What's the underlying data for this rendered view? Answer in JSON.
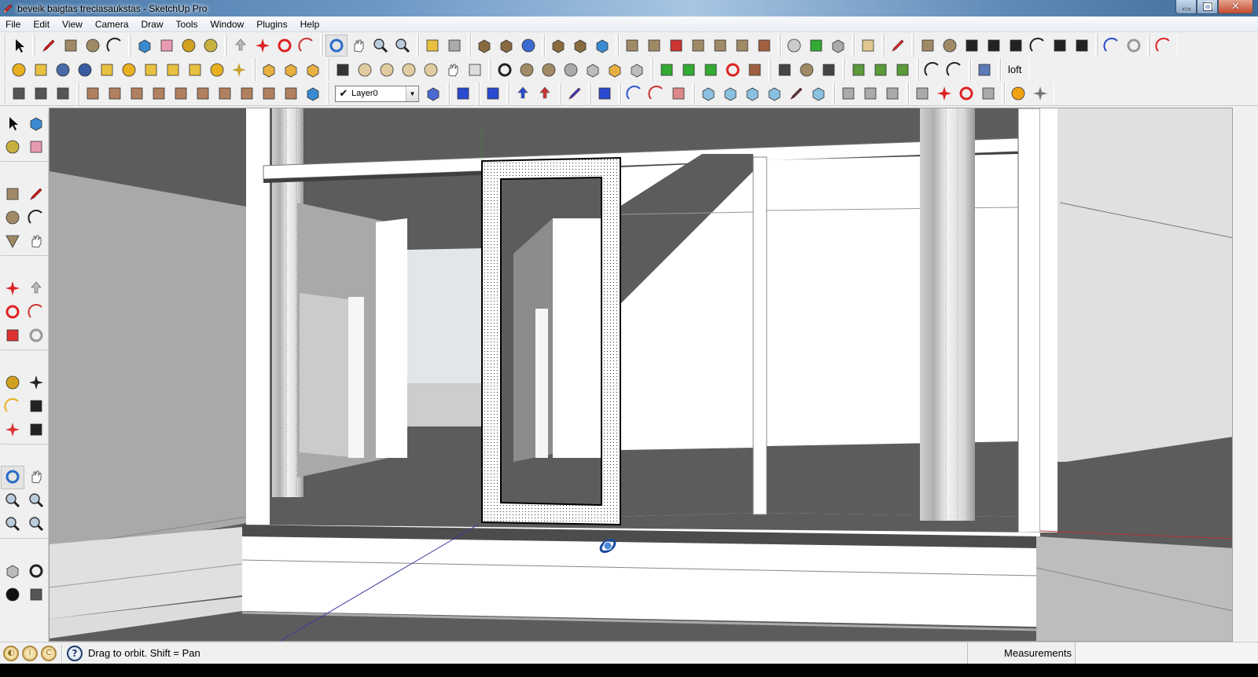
{
  "window": {
    "title": "beveik baigtas treciasaukstas - SketchUp Pro",
    "app_icon": "sketchup-pencil-icon",
    "controls": {
      "minimize": "minimize-icon",
      "restore": "restore-icon",
      "close": "close-icon"
    }
  },
  "menubar": {
    "items": [
      "File",
      "Edit",
      "View",
      "Camera",
      "Draw",
      "Tools",
      "Window",
      "Plugins",
      "Help"
    ]
  },
  "toolbars": {
    "row1": [
      {
        "group": "principal",
        "tools": [
          "select-icon"
        ]
      },
      {
        "group": "drawing",
        "tools": [
          "pencil-line-icon",
          "rectangle-icon",
          "circle-icon",
          "arc-icon"
        ]
      },
      {
        "group": "principal2",
        "tools": [
          "make-component-icon",
          "eraser-icon",
          "tape-measure-icon",
          "paint-bucket-icon"
        ]
      },
      {
        "group": "modification",
        "tools": [
          "push-pull-icon",
          "move-icon",
          "rotate-icon",
          "follow-me-icon"
        ]
      },
      {
        "group": "camera",
        "tools": [
          "orbit-icon",
          "pan-icon",
          "zoom-icon",
          "zoom-extents-icon"
        ]
      },
      {
        "group": "google",
        "tools": [
          "add-location-icon",
          "toggle-terrain-icon"
        ]
      },
      {
        "group": "google2",
        "tools": [
          "get-models-icon",
          "place-model-icon",
          "google-earth-icon"
        ]
      },
      {
        "group": "warehouse",
        "tools": [
          "get-model-icon",
          "share-model-icon",
          "share-component-icon"
        ]
      },
      {
        "group": "sandbox",
        "tools": [
          "from-contours-icon",
          "from-scratch-icon",
          "smoove-icon",
          "stamp-icon",
          "drape-icon",
          "add-detail-icon",
          "flip-edge-icon"
        ]
      },
      {
        "group": "plugins-a",
        "tools": [
          "shell-icon",
          "joint-push-icon",
          "soap-skin-icon"
        ]
      },
      {
        "group": "plugins-b",
        "tools": [
          "curviloft-icon"
        ]
      },
      {
        "group": "plugins-c",
        "tools": [
          "bezier-edit-icon"
        ]
      },
      {
        "group": "shape-bender",
        "tools": [
          "cloud-rectangle-icon",
          "cloud-circle-icon",
          "cloud-polygon-icon",
          "cloud-ellipse-icon",
          "cloud-parallelogram-icon",
          "cloud-arc-icon",
          "cloud-spiral-icon",
          "cloud-freehand-icon"
        ]
      },
      {
        "group": "plugins-d",
        "tools": [
          "polyline-icon",
          "offset-icon"
        ]
      },
      {
        "group": "plugins-e",
        "tools": [
          "extrude-edge-icon"
        ]
      }
    ],
    "row2": [
      {
        "group": "plugins-f",
        "tools": [
          "m-badge-icon",
          "tag-o-icon",
          "r-badge-icon",
          "help-question-icon",
          "tag-f-icon",
          "sphere-icon",
          "light-icon",
          "spotlight-icon",
          "area-light-icon",
          "sphere-outline-icon",
          "crossed-lines-icon"
        ]
      },
      {
        "group": "solid",
        "tools": [
          "solid-union-icon",
          "solid-intersect-icon",
          "solid-subtract-icon"
        ]
      },
      {
        "group": "smooth",
        "tools": [
          "blend-image-icon",
          "blob-1-icon",
          "blob-2-icon",
          "blob-3-icon",
          "blob-4-icon",
          "hand-grab-icon",
          "lock-square-icon"
        ]
      },
      {
        "group": "views",
        "tools": [
          "target-plus-icon",
          "eye-circle-icon",
          "lock-circle-icon",
          "film-reel-icon",
          "camera-frustum-icon",
          "camera-solid-icon",
          "delete-cameras-icon"
        ]
      },
      {
        "group": "joint",
        "tools": [
          "joint-push-j-icon",
          "joint-push-v-icon",
          "joint-push-n-icon",
          "push-rotate-icon",
          "push-flip-icon"
        ]
      },
      {
        "group": "ends",
        "tools": [
          "end-square-icon",
          "end-circle-icon",
          "end-star-icon"
        ]
      },
      {
        "group": "grass",
        "tools": [
          "grass-red-icon",
          "grass-yellow-icon",
          "grass-erase-icon"
        ]
      },
      {
        "group": "bend",
        "tools": [
          "arc-bend-icon",
          "arc-bend-2-icon"
        ]
      },
      {
        "group": "ribbon",
        "tools": [
          "ribbon-icon"
        ]
      },
      {
        "group": "loft",
        "label": "loft"
      }
    ],
    "row3": [
      {
        "group": "section",
        "tools": [
          "section-plane-icon",
          "section-cut-icon",
          "section-save-icon"
        ]
      },
      {
        "group": "surface",
        "tools": [
          "surface-mesh-icon",
          "surface-t-icon",
          "surface-t-box-icon",
          "surface-half-icon",
          "surface-color-icon",
          "surface-frame-icon",
          "surface-layer-icon",
          "surface-grid-t-icon",
          "surface-grid-icon",
          "surface-half-2-icon",
          "surface-component-icon"
        ]
      },
      {
        "group": "layers",
        "layer_select": {
          "value": "Layer0",
          "checked": true
        },
        "tools": [
          "layer-manager-icon"
        ]
      },
      {
        "group": "twist",
        "tools": [
          "twist-face-icon"
        ]
      },
      {
        "group": "face",
        "tools": [
          "face-blue-icon"
        ]
      },
      {
        "group": "arrows",
        "tools": [
          "arrows-updown-blue-icon",
          "arrows-updown-red-icon"
        ]
      },
      {
        "group": "diag",
        "tools": [
          "diagonal-arrow-icon"
        ]
      },
      {
        "group": "hourglass",
        "tools": [
          "hourglass-face-icon"
        ]
      },
      {
        "group": "undo",
        "tools": [
          "curl-blue-icon",
          "curl-red-icon",
          "pipe-icon"
        ]
      },
      {
        "group": "cubes",
        "tools": [
          "cube-blue-icon",
          "cube-wire-icon",
          "cube-gray-icon",
          "cube-half-icon",
          "sword-icon",
          "cube-green-icon"
        ]
      },
      {
        "group": "terrain",
        "tools": [
          "terrain-push-icon",
          "terrain-pin-icon",
          "terrain-brush-icon"
        ]
      },
      {
        "group": "terrain2",
        "tools": [
          "terrain-rainbow-icon",
          "terrain-move-icon",
          "terrain-rotate-icon",
          "terrain-stamp-icon"
        ]
      },
      {
        "group": "misc",
        "tools": [
          "orange-compass-icon",
          "tools-wrench-icon"
        ]
      }
    ]
  },
  "left_toolbar": {
    "groups": [
      [
        "select-icon",
        "make-component-icon",
        "paint-bucket-icon",
        "eraser-icon"
      ],
      [
        "rectangle-icon",
        "pencil-line-icon",
        "circle-icon",
        "arc-icon",
        "polygon-icon",
        "freehand-icon"
      ],
      [
        "move-icon",
        "push-pull-icon",
        "rotate-icon",
        "follow-me-icon",
        "scale-icon",
        "offset-icon"
      ],
      [
        "tape-measure-icon",
        "dimension-icon",
        "protractor-icon",
        "text-icon",
        "axes-icon",
        "3d-text-icon"
      ],
      [
        "orbit-icon",
        "pan-icon",
        "zoom-icon",
        "zoom-window-icon",
        "previous-view-icon",
        "next-view-icon"
      ],
      [
        "position-camera-icon",
        "look-around-icon",
        "walk-icon",
        "section-plane-icon"
      ]
    ],
    "active": "orbit-icon"
  },
  "viewport": {
    "cursor": "orbit-cursor-icon",
    "colors": {
      "dark_gray": "#5c5c5c",
      "mid_gray": "#a9a9a9",
      "light_gray": "#e0e0e0",
      "white": "#ffffff",
      "blue_axis": "#3a3aa0",
      "red_axis": "#b03030",
      "green_axis": "#2e9a2e"
    }
  },
  "statusbar": {
    "icons": [
      "geo-location-icon",
      "credits-icon",
      "copyright-icon"
    ],
    "help_icon": "help-question-icon",
    "message": "Drag to orbit.  Shift = Pan",
    "measurements_label": "Measurements",
    "measurements_value": ""
  }
}
